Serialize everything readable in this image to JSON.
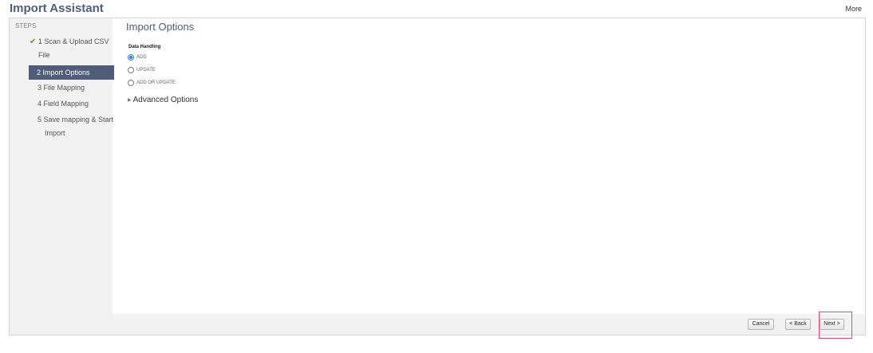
{
  "header": {
    "title": "Import Assistant",
    "more_label": "More"
  },
  "sidebar": {
    "header": "STEPS",
    "steps": [
      {
        "line1": "1 Scan & Upload CSV",
        "line2": "File",
        "status": "complete"
      },
      {
        "line1": "2 Import Options",
        "status": "active"
      },
      {
        "line1": "3 File Mapping"
      },
      {
        "line1": "4 Field Mapping"
      },
      {
        "line1": "5 Save mapping & Start",
        "line2": "Import"
      }
    ],
    "check_icon": "checkmark-icon"
  },
  "main": {
    "title": "Import Options",
    "data_handling": {
      "label": "Data Handling",
      "options": [
        {
          "label": "ADD",
          "selected": true
        },
        {
          "label": "UPDATE",
          "selected": false
        },
        {
          "label": "ADD OR UPDATE",
          "selected": false
        }
      ]
    },
    "advanced_options": {
      "label": "Advanced Options",
      "icon": "caret-right-icon"
    }
  },
  "footer": {
    "cancel_label": "Cancel",
    "back_label": "< Back",
    "next_label": "Next >"
  },
  "colors": {
    "accent": "#4f5d7a",
    "title": "#4d5f79",
    "check": "#5aa02c",
    "radio_selected": "#2d7ad6",
    "highlight": "#e0457b"
  }
}
